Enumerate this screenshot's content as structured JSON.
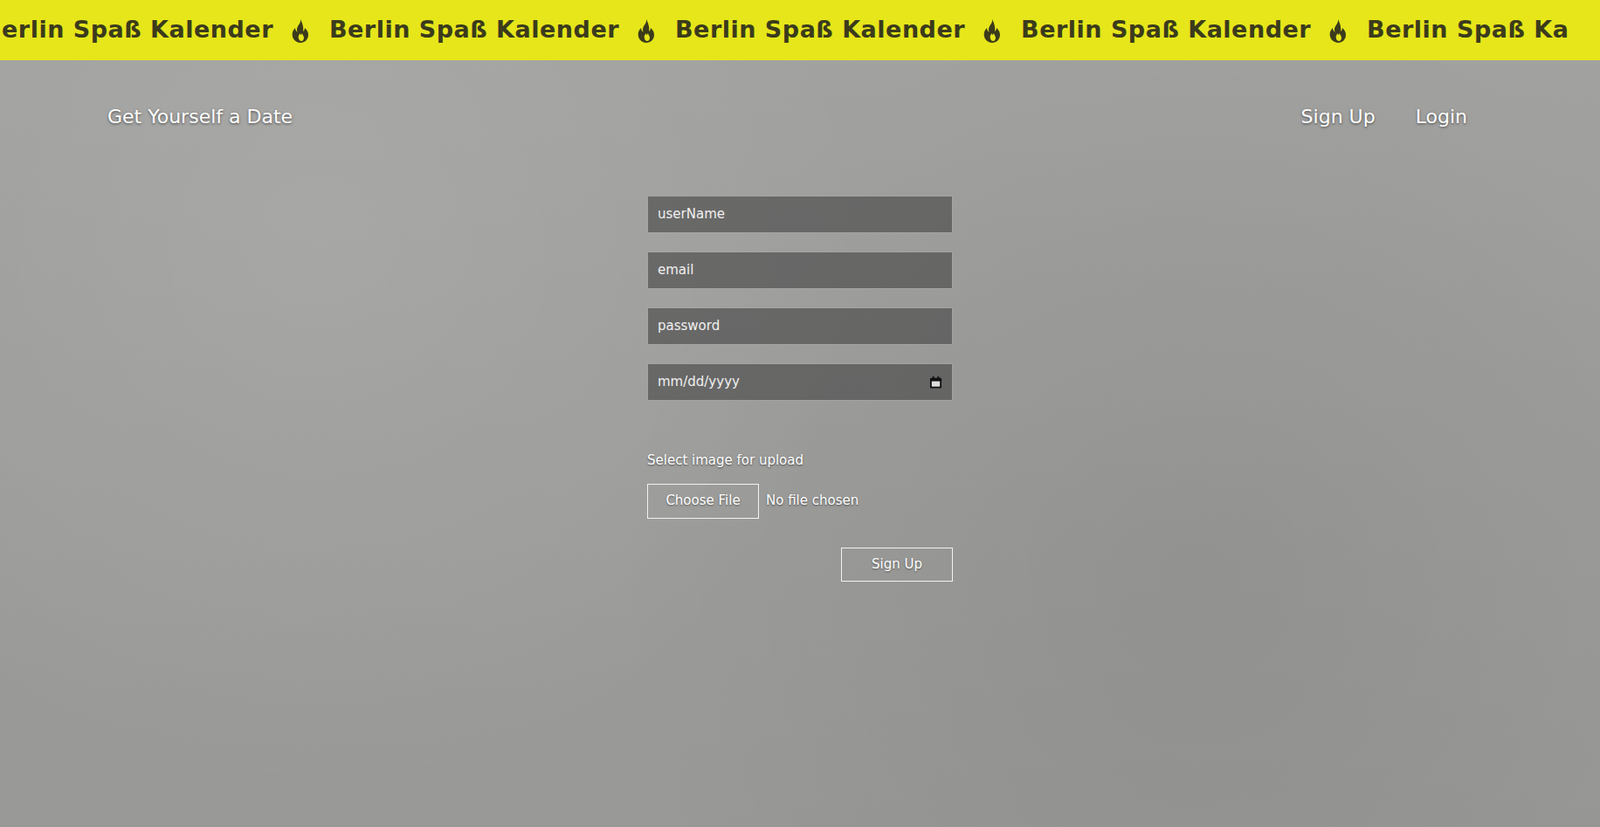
{
  "ticker": {
    "items": [
      "erlin Spaß Kalender",
      "Berlin Spaß Kalender",
      "Berlin Spaß Kalender",
      "Berlin Spaß Kalender",
      "Berlin Spaß Ka"
    ]
  },
  "navbar": {
    "brand": "Get Yourself a Date",
    "links": [
      {
        "label": "Sign Up"
      },
      {
        "label": "Login"
      }
    ]
  },
  "form": {
    "fields": [
      {
        "placeholder": "userName",
        "kind": "text"
      },
      {
        "placeholder": "email",
        "kind": "email"
      },
      {
        "placeholder": "password",
        "kind": "password"
      },
      {
        "placeholder": "mm/dd/yyyy",
        "kind": "date"
      }
    ],
    "upload": {
      "label": "Select image for upload",
      "button": "Choose File",
      "status": "No file chosen"
    },
    "submit": "Sign Up"
  }
}
